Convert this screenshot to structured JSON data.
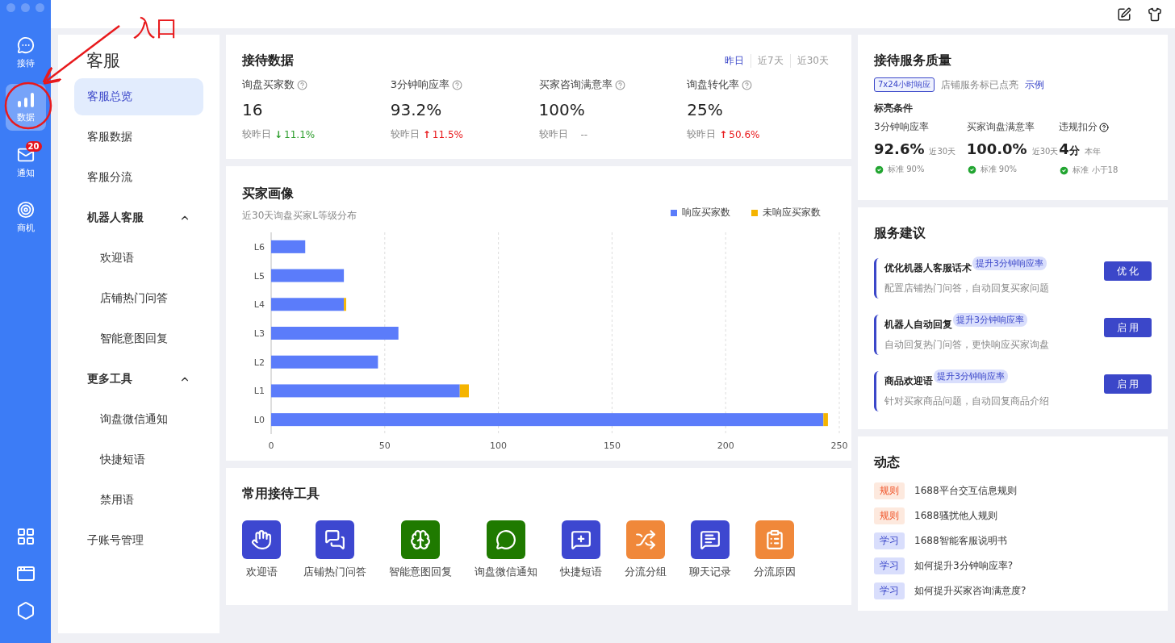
{
  "annotation": {
    "label": "入口"
  },
  "rail": {
    "items": [
      {
        "label": "接待",
        "selected": false
      },
      {
        "label": "数据",
        "selected": true
      },
      {
        "label": "通知",
        "selected": false,
        "badge": "20"
      },
      {
        "label": "商机",
        "selected": false
      }
    ]
  },
  "nav": {
    "title": "客服",
    "items": [
      {
        "label": "客服总览",
        "selected": true
      },
      {
        "label": "客服数据",
        "selected": false
      },
      {
        "label": "客服分流",
        "selected": false
      },
      {
        "label": "机器人客服",
        "selected": false,
        "expanded": true,
        "children": [
          {
            "label": "欢迎语",
            "selected": false
          },
          {
            "label": "店铺热门问答",
            "selected": false
          },
          {
            "label": "智能意图回复",
            "selected": false
          }
        ]
      },
      {
        "label": "更多工具",
        "selected": false,
        "expanded": true,
        "children": [
          {
            "label": "询盘微信通知",
            "selected": false
          },
          {
            "label": "快捷短语",
            "selected": false
          },
          {
            "label": "禁用语",
            "selected": false
          }
        ]
      },
      {
        "label": "子账号管理",
        "selected": false
      }
    ]
  },
  "reception": {
    "title": "接待数据",
    "periods": [
      {
        "label": "昨日",
        "selected": true
      },
      {
        "label": "近7天",
        "selected": false
      },
      {
        "label": "近30天",
        "selected": false
      }
    ],
    "metrics": [
      {
        "label": "询盘买家数",
        "value": "16",
        "compare": "较昨日",
        "arrow": "↓",
        "color": "#2f9e2f",
        "delta": "11.1%"
      },
      {
        "label": "3分钟响应率",
        "value": "93.2%",
        "compare": "较昨日",
        "arrow": "↑",
        "color": "#e8191c",
        "delta": "11.5%"
      },
      {
        "label": "买家咨询满意率",
        "value": "100%",
        "compare": "较昨日",
        "color": "#888888",
        "delta": "--"
      },
      {
        "label": "询盘转化率",
        "value": "25%",
        "compare": "较昨日",
        "arrow": "↑",
        "color": "#e8191c",
        "delta": "50.6%"
      }
    ]
  },
  "portrait": {
    "title": "买家画像",
    "subtitle": "近30天询盘买家L等级分布",
    "chart_data": {
      "type": "bar",
      "orientation": "horizontal",
      "stacked": true,
      "categories": [
        "L6",
        "L5",
        "L4",
        "L3",
        "L2",
        "L1",
        "L0"
      ],
      "series": [
        {
          "name": "响应买家数",
          "color": "#5b7cfa",
          "values": [
            15,
            32,
            32,
            56,
            47,
            83,
            243
          ]
        },
        {
          "name": "未响应买家数",
          "color": "#f5b400",
          "values": [
            0,
            0,
            1,
            0,
            0,
            4,
            2
          ]
        }
      ],
      "grid": true,
      "xlim": [
        0,
        250
      ],
      "xticks": [
        0,
        50,
        100,
        150,
        200,
        250
      ]
    }
  },
  "tools": {
    "title": "常用接待工具",
    "items": [
      {
        "label": "欢迎语",
        "color": "#3d47d0"
      },
      {
        "label": "店铺热门问答",
        "color": "#3d47d0"
      },
      {
        "label": "智能意图回复",
        "color": "#1f7a00"
      },
      {
        "label": "询盘微信通知",
        "color": "#1f7a00"
      },
      {
        "label": "快捷短语",
        "color": "#3d47d0"
      },
      {
        "label": "分流分组",
        "color": "#f0883a"
      },
      {
        "label": "聊天记录",
        "color": "#3d47d0"
      },
      {
        "label": "分流原因",
        "color": "#f0883a"
      }
    ]
  },
  "quality": {
    "title": "接待服务质量",
    "badge": "7x24小时响应",
    "status": "店铺服务标已点亮",
    "link": "示例",
    "subtitle": "标亮条件",
    "items": [
      {
        "label": "3分钟响应率",
        "value": "92.6%",
        "period": "近30天",
        "passed": true,
        "standard": "标准 90%"
      },
      {
        "label": "买家询盘满意率",
        "value": "100.0%",
        "period": "近30天",
        "passed": true,
        "standard": "标准 90%"
      },
      {
        "label": "违规扣分",
        "help": true,
        "value": "4",
        "unit": "分",
        "period": "本年",
        "passed": true,
        "standard": "标准 小于18"
      }
    ]
  },
  "suggestions": {
    "title": "服务建议",
    "items": [
      {
        "title": "优化机器人客服话术",
        "tag": "提升3分钟响应率",
        "desc": "配置店铺热门问答，自动回复买家问题",
        "button": "优 化"
      },
      {
        "title": "机器人自动回复",
        "tag": "提升3分钟响应率",
        "desc": "自动回复热门问答，更快响应买家询盘",
        "button": "启 用"
      },
      {
        "title": "商品欢迎语",
        "tag": "提升3分钟响应率",
        "desc": "针对买家商品问题，自动回复商品介绍",
        "button": "启 用"
      }
    ]
  },
  "news": {
    "title": "动态",
    "items": [
      {
        "kind": "rule",
        "tag": "规则",
        "text": "1688平台交互信息规则"
      },
      {
        "kind": "rule",
        "tag": "规则",
        "text": "1688骚扰他人规则"
      },
      {
        "kind": "study",
        "tag": "学习",
        "text": "1688智能客服说明书"
      },
      {
        "kind": "study",
        "tag": "学习",
        "text": "如何提升3分钟响应率?"
      },
      {
        "kind": "study",
        "tag": "学习",
        "text": "如何提升买家咨询满意度?"
      }
    ]
  }
}
